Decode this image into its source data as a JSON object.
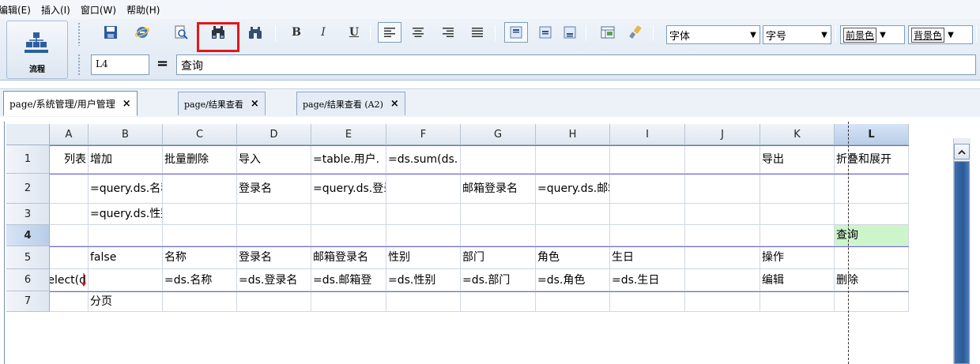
{
  "menu": [
    "编辑(E)",
    "插入(I)",
    "窗口(W)",
    "帮助(H)"
  ],
  "flow_panel": {
    "label": "流程",
    "icon": "flow-hierarchy-icon"
  },
  "toolbar": {
    "buttons": [
      {
        "name": "save-icon",
        "kind": "save"
      },
      {
        "name": "preview-web-icon",
        "kind": "ie"
      },
      {
        "name": "print-preview-icon",
        "kind": "printpreview"
      },
      {
        "name": "find-icon",
        "kind": "find",
        "highlighted": true
      },
      {
        "name": "find-replace-icon",
        "kind": "binoculars"
      },
      {
        "name": "bold-icon",
        "kind": "text",
        "text": "B"
      },
      {
        "name": "italic-icon",
        "kind": "text",
        "text": "I"
      },
      {
        "name": "underline-icon",
        "kind": "text",
        "text": "U"
      },
      {
        "name": "align-left-icon",
        "kind": "align"
      },
      {
        "name": "align-center-icon",
        "kind": "align"
      },
      {
        "name": "align-right-icon",
        "kind": "align"
      },
      {
        "name": "align-justify-icon",
        "kind": "align"
      },
      {
        "name": "valign-top-icon",
        "kind": "valign"
      },
      {
        "name": "valign-middle-icon",
        "kind": "valign"
      },
      {
        "name": "valign-bottom-icon",
        "kind": "valign"
      },
      {
        "name": "merge-cells-icon",
        "kind": "merge"
      },
      {
        "name": "format-brush-icon",
        "kind": "brush"
      }
    ],
    "font_family": "字体",
    "font_size": "字号",
    "foreground": "前景色",
    "background": "背景色"
  },
  "cell_ref": "L4",
  "formula_eq": "=",
  "formula_value": "查询",
  "tabs": [
    {
      "label": "page/系统管理/用户管理",
      "close": "×",
      "active": true
    },
    {
      "label": "page/结果查看",
      "close": "×",
      "active": false
    },
    {
      "label": "page/结果查看 (A2)",
      "close": "×",
      "active": false
    }
  ],
  "columns": [
    "A",
    "B",
    "C",
    "D",
    "E",
    "F",
    "G",
    "H",
    "I",
    "J",
    "K",
    "L"
  ],
  "selected_column": "L",
  "rows": [
    "1",
    "2",
    "3",
    "4",
    "5",
    "6",
    "7"
  ],
  "selected_row": "4",
  "cells": {
    "A1": "列表",
    "B1": "增加",
    "C1": "批量删除",
    "D1": "导入",
    "E1": "=table.用户.",
    "F1": "=ds.sum(ds.",
    "K1": "导出",
    "L1": "折叠和展开",
    "B2": "=query.ds.名称",
    "D2": "登录名",
    "E2": "=query.ds.登录名",
    "G2": "邮箱登录名",
    "H2": "=query.ds.邮箱登录名",
    "B3": "=query.ds.性别",
    "L4": "查询",
    "B5": "false",
    "C5": "名称",
    "D5": "登录名",
    "E5": "邮箱登录名",
    "F5": "性别",
    "G5": "部门",
    "H5": "角色",
    "I5": "生日",
    "K5": "操作",
    "A6": "select(d",
    "C6": "=ds.名称",
    "D6": "=ds.登录名",
    "E6": "=ds.邮箱登",
    "F6": "=ds.性别",
    "G6": "=ds.部门",
    "H6": "=ds.角色",
    "I6": "=ds.生日",
    "K6": "编辑",
    "L6": "删除",
    "B7": "分页"
  },
  "colors": {
    "selection_fill": "#ccf5cc",
    "band_line": "#6e6bd6",
    "highlight_box": "#e2181b"
  }
}
